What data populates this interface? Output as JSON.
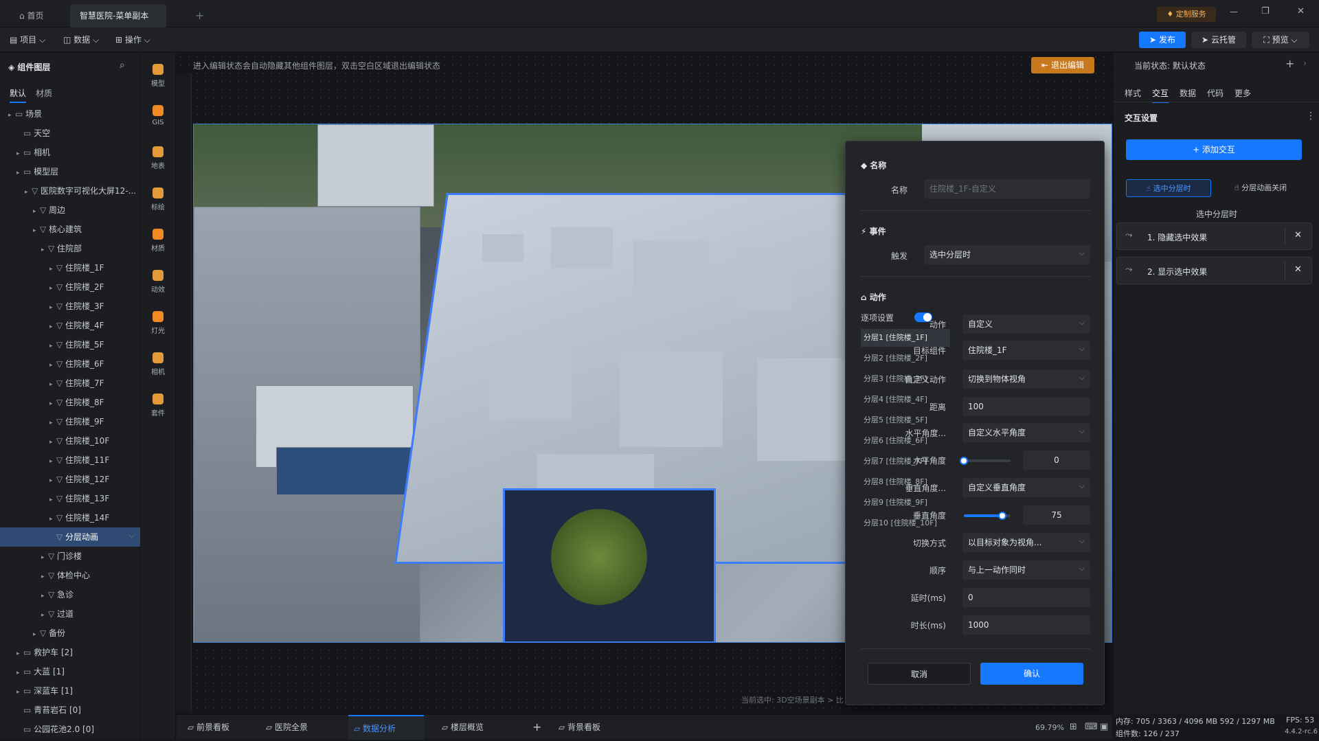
{
  "titlebar": {
    "home_tab": "首页",
    "doc_tab": "智慧医院-菜单副本",
    "plus": "+",
    "service_label": "定制服务",
    "minimize": "—",
    "restore": "❐",
    "close": "✕"
  },
  "menubar": {
    "project": "项目",
    "data": "数据",
    "operate": "操作",
    "publish": "发布",
    "cloud": "云托管",
    "preview": "预览"
  },
  "left": {
    "title": "组件图层",
    "tab_default": "默认",
    "tab_material": "材质",
    "tree": [
      {
        "label": "场景",
        "level": 0
      },
      {
        "label": "天空",
        "level": 1
      },
      {
        "label": "相机",
        "level": 1
      },
      {
        "label": "模型层",
        "level": 1
      },
      {
        "label": "医院数字可视化大屏12-...",
        "level": 2
      },
      {
        "label": "周边",
        "level": 3
      },
      {
        "label": "核心建筑",
        "level": 3
      },
      {
        "label": "住院部",
        "level": 4
      },
      {
        "label": "住院楼_1F",
        "level": 5
      },
      {
        "label": "住院楼_2F",
        "level": 5
      },
      {
        "label": "住院楼_3F",
        "level": 5
      },
      {
        "label": "住院楼_4F",
        "level": 5
      },
      {
        "label": "住院楼_5F",
        "level": 5
      },
      {
        "label": "住院楼_6F",
        "level": 5
      },
      {
        "label": "住院楼_7F",
        "level": 5
      },
      {
        "label": "住院楼_8F",
        "level": 5
      },
      {
        "label": "住院楼_9F",
        "level": 5
      },
      {
        "label": "住院楼_10F",
        "level": 5
      },
      {
        "label": "住院楼_11F",
        "level": 5
      },
      {
        "label": "住院楼_12F",
        "level": 5
      },
      {
        "label": "住院楼_13F",
        "level": 5
      },
      {
        "label": "住院楼_14F",
        "level": 5
      },
      {
        "label": "分层动画",
        "level": 5
      },
      {
        "label": "门诊楼",
        "level": 4
      },
      {
        "label": "体检中心",
        "level": 4
      },
      {
        "label": "急诊",
        "level": 4
      },
      {
        "label": "过道",
        "level": 4
      },
      {
        "label": "备份",
        "level": 3
      },
      {
        "label": "救护车 [2]",
        "level": 1
      },
      {
        "label": "大蓝 [1]",
        "level": 1
      },
      {
        "label": "深蓝车 [1]",
        "level": 1
      },
      {
        "label": "青苔岩石 [0]",
        "level": 1
      },
      {
        "label": "公园花池2.0 [0]",
        "level": 1
      }
    ]
  },
  "tools": [
    "模型",
    "GIS",
    "地表",
    "标绘",
    "材质",
    "动效",
    "灯光",
    "相机",
    "套件"
  ],
  "canvas": {
    "hint": "进入编辑状态会自动隐藏其他组件图层，双击空白区域退出编辑状态",
    "exit_edit": "退出编辑",
    "status": "当前选中: 3D空场景副本 > 比"
  },
  "dialog": {
    "name_section": "名称",
    "name_label": "名称",
    "name_placeholder": "住院楼_1F-自定义",
    "event_section": "事件",
    "trigger_label": "触发",
    "trigger_value": "选中分层时",
    "action_section": "动作",
    "per_item_label": "逐项设置",
    "layers": [
      "分层1 [住院楼_1F]",
      "分层2 [住院楼_2F]",
      "分层3 [住院楼_3F]",
      "分层4 [住院楼_4F]",
      "分层5 [住院楼_5F]",
      "分层6 [住院楼_6F]",
      "分层7 [住院楼_7F]",
      "分层8 [住院楼_8F]",
      "分层9 [住院楼_9F]",
      "分层10 [住院楼_10F]"
    ],
    "fields": {
      "action_label": "动作",
      "action_value": "自定义",
      "target_label": "目标组件",
      "target_value": "住院楼_1F",
      "custom_label": "自定义动作",
      "custom_value": "切换到物体视角",
      "distance_label": "距离",
      "distance_value": "100",
      "hmode_label": "水平角度...",
      "hmode_value": "自定义水平角度",
      "hangle_label": "水平角度",
      "hangle_value": "0",
      "vmode_label": "垂直角度...",
      "vmode_value": "自定义垂直角度",
      "vangle_label": "垂直角度",
      "vangle_value": "75",
      "switch_label": "切换方式",
      "switch_value": "以目标对象为视角...",
      "order_label": "顺序",
      "order_value": "与上一动作同时",
      "delay_label": "延时(ms)",
      "delay_value": "0",
      "duration_label": "时长(ms)",
      "duration_value": "1000"
    },
    "hangle_fraction": 0.0,
    "vangle_fraction": 0.83,
    "cancel": "取消",
    "confirm": "确认"
  },
  "right": {
    "state_label": "当前状态:",
    "state_value": "默认状态",
    "tabs": [
      "样式",
      "交互",
      "数据",
      "代码",
      "更多"
    ],
    "section": "交互设置",
    "add_interaction": "+ 添加交互",
    "chip_selected": "选中分层时",
    "chip_closed": "分层动画关闭",
    "group_title": "选中分层时",
    "actions": [
      "1. 隐藏选中效果",
      "2. 显示选中效果"
    ]
  },
  "bottom": {
    "tabs": [
      "前景看板",
      "医院全景",
      "数据分析",
      "楼层概览",
      "背景看板"
    ],
    "zoom": "69.79%",
    "memory": "内存: 705 / 3363 / 4096 MB  592 / 1297 MB",
    "components": "组件数: 126 / 237",
    "fps": "FPS: 53",
    "version": "4.4.2-rc.6"
  },
  "colors": {
    "accent": "#1677ff",
    "exit_orange": "#c8781c",
    "selected_tree": "#2f4b73"
  }
}
